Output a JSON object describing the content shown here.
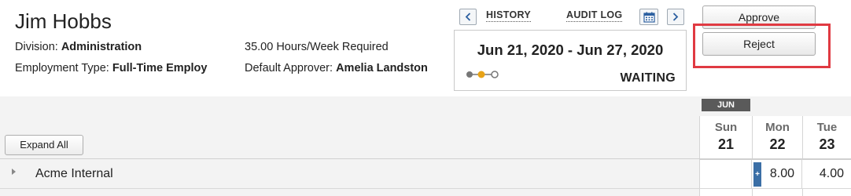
{
  "employee": {
    "name": "Jim Hobbs",
    "division_label": "Division:",
    "division_value": "Administration",
    "employment_type_label": "Employment Type:",
    "employment_type_value": "Full-Time Employ",
    "hours_required": "35.00 Hours/Week Required",
    "approver_label": "Default Approver:",
    "approver_value": "Amelia Landston"
  },
  "nav": {
    "history_label": "HISTORY",
    "audit_log_label": "AUDIT LOG",
    "prev_icon": "chevron-left-icon",
    "next_icon": "chevron-right-icon",
    "calendar_icon": "calendar-icon"
  },
  "period": {
    "range": "Jun 21, 2020 - Jun 27, 2020",
    "status": "WAITING"
  },
  "actions": {
    "approve_label": "Approve",
    "reject_label": "Reject"
  },
  "grid": {
    "month": "JUN",
    "expand_all_label": "Expand All",
    "days": [
      {
        "name": "Sun",
        "num": "21"
      },
      {
        "name": "Mon",
        "num": "22"
      },
      {
        "name": "Tue",
        "num": "23"
      }
    ],
    "rows": [
      {
        "label": "Acme Internal",
        "values": [
          "",
          "8.00",
          "4.00"
        ],
        "add_symbol": "+"
      }
    ]
  },
  "colors": {
    "highlight": "#e03a42",
    "accent": "#3b6fa6",
    "progress_active": "#e8a317"
  }
}
